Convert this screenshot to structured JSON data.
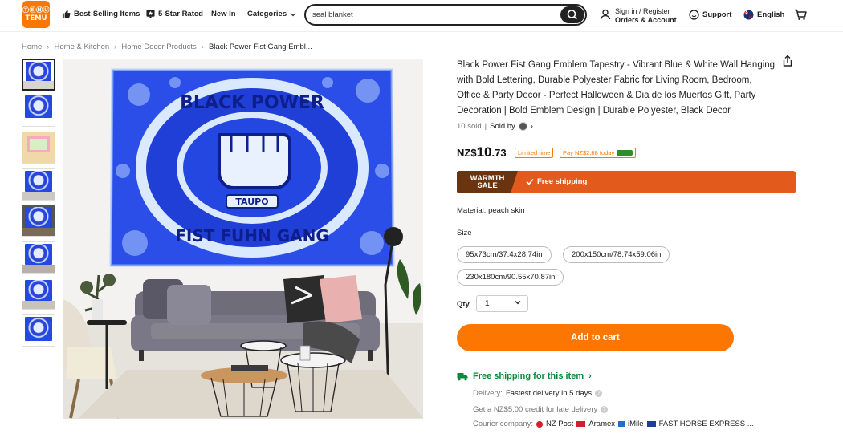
{
  "header": {
    "logo_line1": "ⓉⒺⓂⓊ",
    "logo_line2": "TEMU",
    "nav": {
      "best_selling": "Best-Selling Items",
      "five_star": "5-Star Rated",
      "new_in": "New In",
      "categories": "Categories"
    },
    "search_value": "seal blanket",
    "account_line1": "Sign in / Register",
    "account_line2": "Orders & Account",
    "support": "Support",
    "language": "English"
  },
  "breadcrumb": [
    "Home",
    "Home & Kitchen",
    "Home Decor Products",
    "Black Power Fist Gang Embl..."
  ],
  "product": {
    "title": "Black Power Fist Gang Emblem Tapestry - Vibrant Blue & White Wall Hanging with Bold Lettering, Durable Polyester Fabric for Living Room, Bedroom, Office & Party Decor - Perfect Halloween & Dia de los Muertos Gift, Party Decoration | Bold Emblem Design | Durable Polyester, Black Decor",
    "sold": "10 sold",
    "sold_by": "Sold by",
    "price_currency": "NZ$",
    "price_whole": "10",
    "price_cents": ".73",
    "badge_limited": "Limited time",
    "badge_pay": "Pay NZ$2.68 today",
    "banner_line1": "WARMTH",
    "banner_line2": "SALE",
    "banner_free": "Free shipping",
    "material": "Material: peach skin",
    "size_label": "Size",
    "sizes": [
      "95x73cm/37.4x28.74in",
      "200x150cm/78.74x59.06in",
      "230x180cm/90.55x70.87in"
    ],
    "qty_label": "Qty",
    "qty_value": "1",
    "add_to_cart": "Add to cart",
    "image_text": {
      "top": "BLACK POWER",
      "bottom": "FIST FUHN GANG",
      "center": "TAUPO"
    }
  },
  "shipping": {
    "heading": "Free shipping for this item",
    "delivery_prefix": "Delivery:",
    "delivery_value": "Fastest delivery in 5 days",
    "credit": "Get a NZ$5.00 credit for late delivery",
    "courier_prefix": "Courier company:",
    "couriers": [
      "NZ Post",
      "Aramex",
      "iMile",
      "FAST HORSE EXPRESS ..."
    ]
  },
  "colors": {
    "brand": "#fb7701",
    "green": "#0a8a3a",
    "banner": "#e25b1c"
  }
}
